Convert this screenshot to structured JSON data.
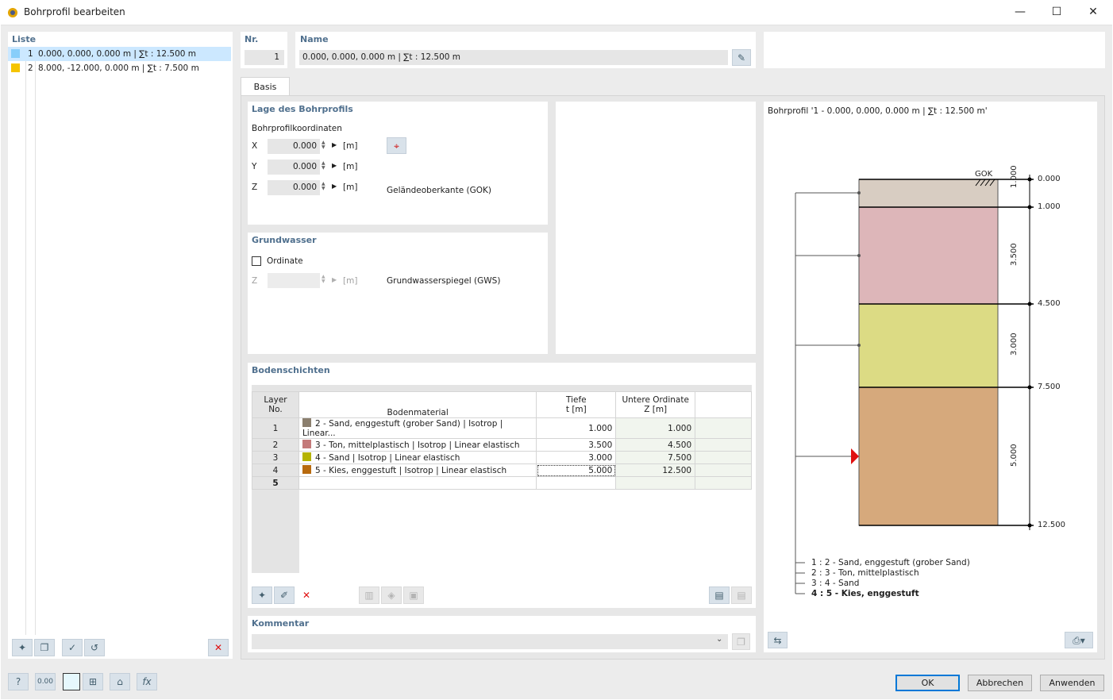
{
  "window": {
    "title": "Bohrprofil bearbeiten",
    "min_glyph": "—",
    "max_glyph": "☐",
    "close_glyph": "✕"
  },
  "list": {
    "header": "Liste",
    "items": [
      {
        "no": "1",
        "label": "0.000, 0.000, 0.000 m | ∑t : 12.500 m",
        "color": "#87cefa"
      },
      {
        "no": "2",
        "label": "8.000, -12.000, 0.000 m | ∑t : 7.500 m",
        "color": "#f5c400"
      }
    ]
  },
  "nr": {
    "label": "Nr.",
    "value": "1"
  },
  "name": {
    "label": "Name",
    "value": "0.000, 0.000, 0.000 m | ∑t : 12.500 m"
  },
  "tab": {
    "label": "Basis"
  },
  "lage": {
    "header": "Lage des Bohrprofils",
    "sub": "Bohrprofilkoordinaten",
    "x_label": "X",
    "x_value": "0.000",
    "y_label": "Y",
    "y_value": "0.000",
    "z_label": "Z",
    "z_value": "0.000",
    "unit": "[m]",
    "gok_label": "Geländeoberkante (GOK)"
  },
  "grundwasser": {
    "header": "Grundwasser",
    "checkbox_label": "Ordinate",
    "z_label": "Z",
    "z_value": "",
    "unit": "[m]",
    "gws_label": "Grundwasserspiegel (GWS)"
  },
  "bodenschichten": {
    "header": "Bodenschichten",
    "columns": {
      "layer_1": "Layer",
      "layer_2": "No.",
      "material": "Bodenmaterial",
      "tiefe_1": "Tiefe",
      "tiefe_2": "t [m]",
      "ord_1": "Untere Ordinate",
      "ord_2": "Z [m]"
    },
    "rows": [
      {
        "no": "1",
        "material": "2 - Sand, enggestuft (grober Sand) | Isotrop | Linear...",
        "color": "#8b7f6e",
        "t": "1.000",
        "z": "1.000"
      },
      {
        "no": "2",
        "material": "3 - Ton, mittelplastisch | Isotrop | Linear elastisch",
        "color": "#c47a7a",
        "t": "3.500",
        "z": "4.500"
      },
      {
        "no": "3",
        "material": "4 - Sand | Isotrop | Linear elastisch",
        "color": "#b5b300",
        "t": "3.000",
        "z": "7.500"
      },
      {
        "no": "4",
        "material": "5 - Kies, enggestuft | Isotrop | Linear elastisch",
        "color": "#b86a0e",
        "t": "5.000",
        "z": "12.500"
      },
      {
        "no": "5",
        "material": "",
        "color": "",
        "t": "",
        "z": ""
      }
    ]
  },
  "kommentar": {
    "header": "Kommentar",
    "value": ""
  },
  "profile": {
    "title": "Bohrprofil '1 - 0.000, 0.000, 0.000 m | ∑t : 12.500 m'",
    "gok": "GOK",
    "depth_labels": [
      "0.000",
      "1.000",
      "4.500",
      "7.500",
      "12.500"
    ],
    "thickness_labels": [
      "1.000",
      "3.500",
      "3.000",
      "5.000"
    ],
    "layer_colors": [
      "#d8cdc2",
      "#ddb6b9",
      "#dcdb84",
      "#d6a97c"
    ],
    "legend": [
      "1 :  2 - Sand, enggestuft (grober Sand)",
      "2 :  3 - Ton, mittelplastisch",
      "3 :  4 - Sand",
      "4 :  5 - Kies, enggestuft"
    ]
  },
  "buttons": {
    "ok": "OK",
    "abbrechen": "Abbrechen",
    "anwenden": "Anwenden"
  }
}
